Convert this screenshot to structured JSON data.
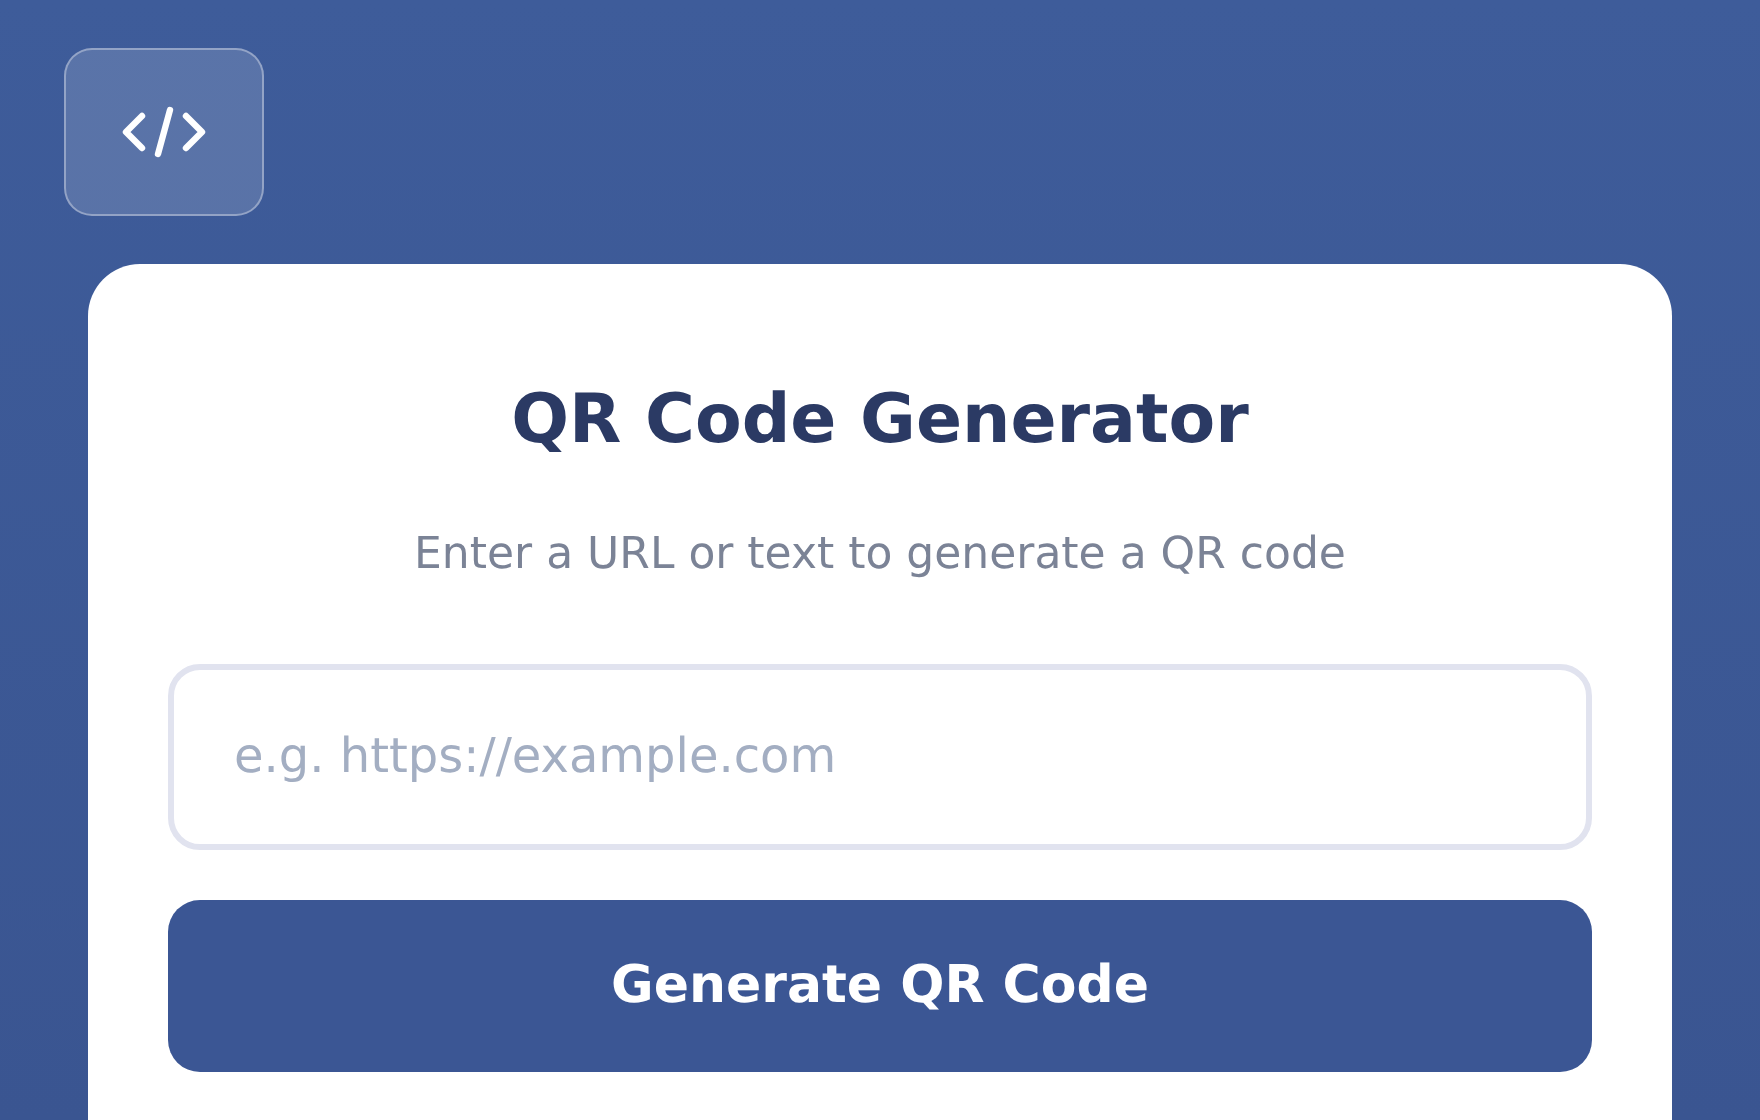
{
  "title": "QR Code Generator",
  "subtitle": "Enter a URL or text to generate a QR code",
  "input": {
    "placeholder": "e.g. https://example.com"
  },
  "button": {
    "label": "Generate QR Code"
  }
}
